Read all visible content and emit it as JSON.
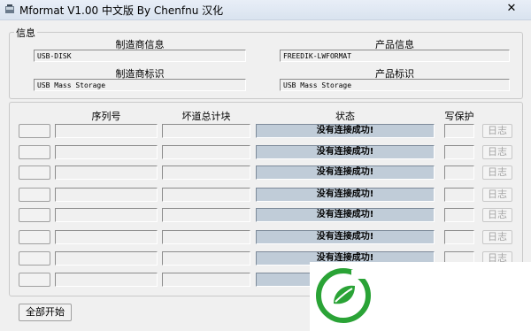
{
  "window": {
    "title": "Mformat V1.00 中文版 By Chenfnu 汉化",
    "close_glyph": "✕"
  },
  "info": {
    "legend": "信息",
    "manufacturer_info_label": "制造商信息",
    "manufacturer_info_value": "USB-DISK",
    "product_info_label": "产品信息",
    "product_info_value": "FREEDIK-LWFORMAT",
    "manufacturer_id_label": "制造商标识",
    "manufacturer_id_value": "USB Mass Storage",
    "product_id_label": "产品标识",
    "product_id_value": "USB Mass Storage"
  },
  "table": {
    "headers": {
      "serial": "序列号",
      "bad_blocks": "坏道总计块",
      "status": "状态",
      "write_protect": "写保护"
    },
    "log_label": "日志",
    "rows": [
      {
        "status": "没有连接成功!"
      },
      {
        "status": "没有连接成功!"
      },
      {
        "status": "没有连接成功!"
      },
      {
        "status": "没有连接成功!"
      },
      {
        "status": "没有连接成功!"
      },
      {
        "status": "没有连接成功!"
      },
      {
        "status": "没有连接成功!"
      },
      {
        "status": ""
      }
    ]
  },
  "footer": {
    "start_all_label": "全部开始"
  },
  "colors": {
    "status_bg": "#c0ccd8",
    "logo_green": "#2aa336"
  },
  "icons": {
    "app": "drive-icon",
    "logo": "leaf-logo"
  }
}
